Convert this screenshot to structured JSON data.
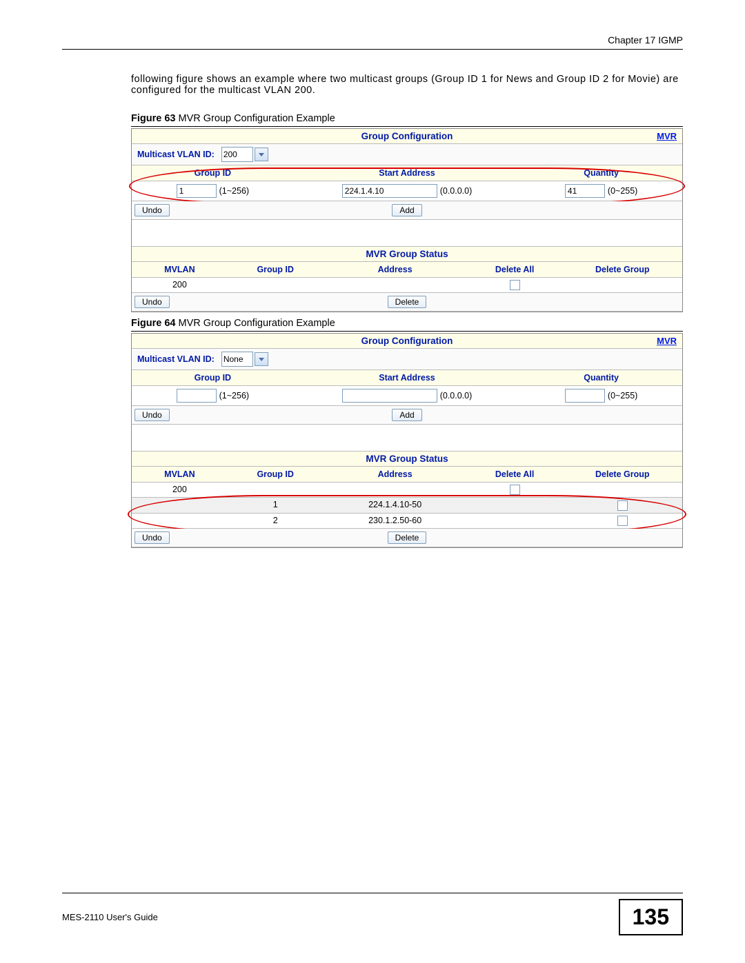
{
  "header": {
    "chapter": "Chapter 17 IGMP"
  },
  "body": {
    "paragraph": "following figure shows an example where two multicast groups (Group ID 1 for News and Group ID 2 for Movie) are configured for the multicast VLAN 200."
  },
  "figure63": {
    "caption_bold": "Figure 63",
    "caption_rest": "   MVR Group Configuration Example",
    "panel_title": "Group Configuration",
    "mvr_link": "MVR",
    "vlan_label": "Multicast VLAN ID:",
    "vlan_value": "200",
    "headers": {
      "group_id": "Group ID",
      "start_addr": "Start Address",
      "quantity": "Quantity"
    },
    "inputs": {
      "group_id": "1",
      "group_hint": "(1~256)",
      "start_addr": "224.1.4.10",
      "start_hint": "(0.0.0.0)",
      "quantity": "41",
      "qty_hint": "(0~255)"
    },
    "buttons": {
      "undo": "Undo",
      "add": "Add",
      "delete": "Delete"
    },
    "status_title": "MVR Group Status",
    "status_headers": {
      "mvlan": "MVLAN",
      "group_id": "Group ID",
      "address": "Address",
      "delete_all": "Delete All",
      "delete_group": "Delete Group"
    },
    "status_rows": [
      {
        "mvlan": "200",
        "group_id": "",
        "address": "",
        "delete_all_chk": true,
        "delete_group_chk": false
      }
    ]
  },
  "figure64": {
    "caption_bold": "Figure 64",
    "caption_rest": "   MVR Group Configuration Example",
    "panel_title": "Group Configuration",
    "mvr_link": "MVR",
    "vlan_label": "Multicast VLAN ID:",
    "vlan_value": "None",
    "headers": {
      "group_id": "Group ID",
      "start_addr": "Start Address",
      "quantity": "Quantity"
    },
    "inputs": {
      "group_id": "",
      "group_hint": "(1~256)",
      "start_addr": "",
      "start_hint": "(0.0.0.0)",
      "quantity": "",
      "qty_hint": "(0~255)"
    },
    "buttons": {
      "undo": "Undo",
      "add": "Add",
      "delete": "Delete"
    },
    "status_title": "MVR Group Status",
    "status_headers": {
      "mvlan": "MVLAN",
      "group_id": "Group ID",
      "address": "Address",
      "delete_all": "Delete All",
      "delete_group": "Delete Group"
    },
    "status_rows": [
      {
        "mvlan": "200",
        "group_id": "",
        "address": "",
        "delete_all_chk": true,
        "delete_group_chk": false
      },
      {
        "mvlan": "",
        "group_id": "1",
        "address": "224.1.4.10-50",
        "delete_all_chk": false,
        "delete_group_chk": true
      },
      {
        "mvlan": "",
        "group_id": "2",
        "address": "230.1.2.50-60",
        "delete_all_chk": false,
        "delete_group_chk": true
      }
    ]
  },
  "footer": {
    "guide": "MES-2110 User's Guide",
    "page": "135"
  }
}
